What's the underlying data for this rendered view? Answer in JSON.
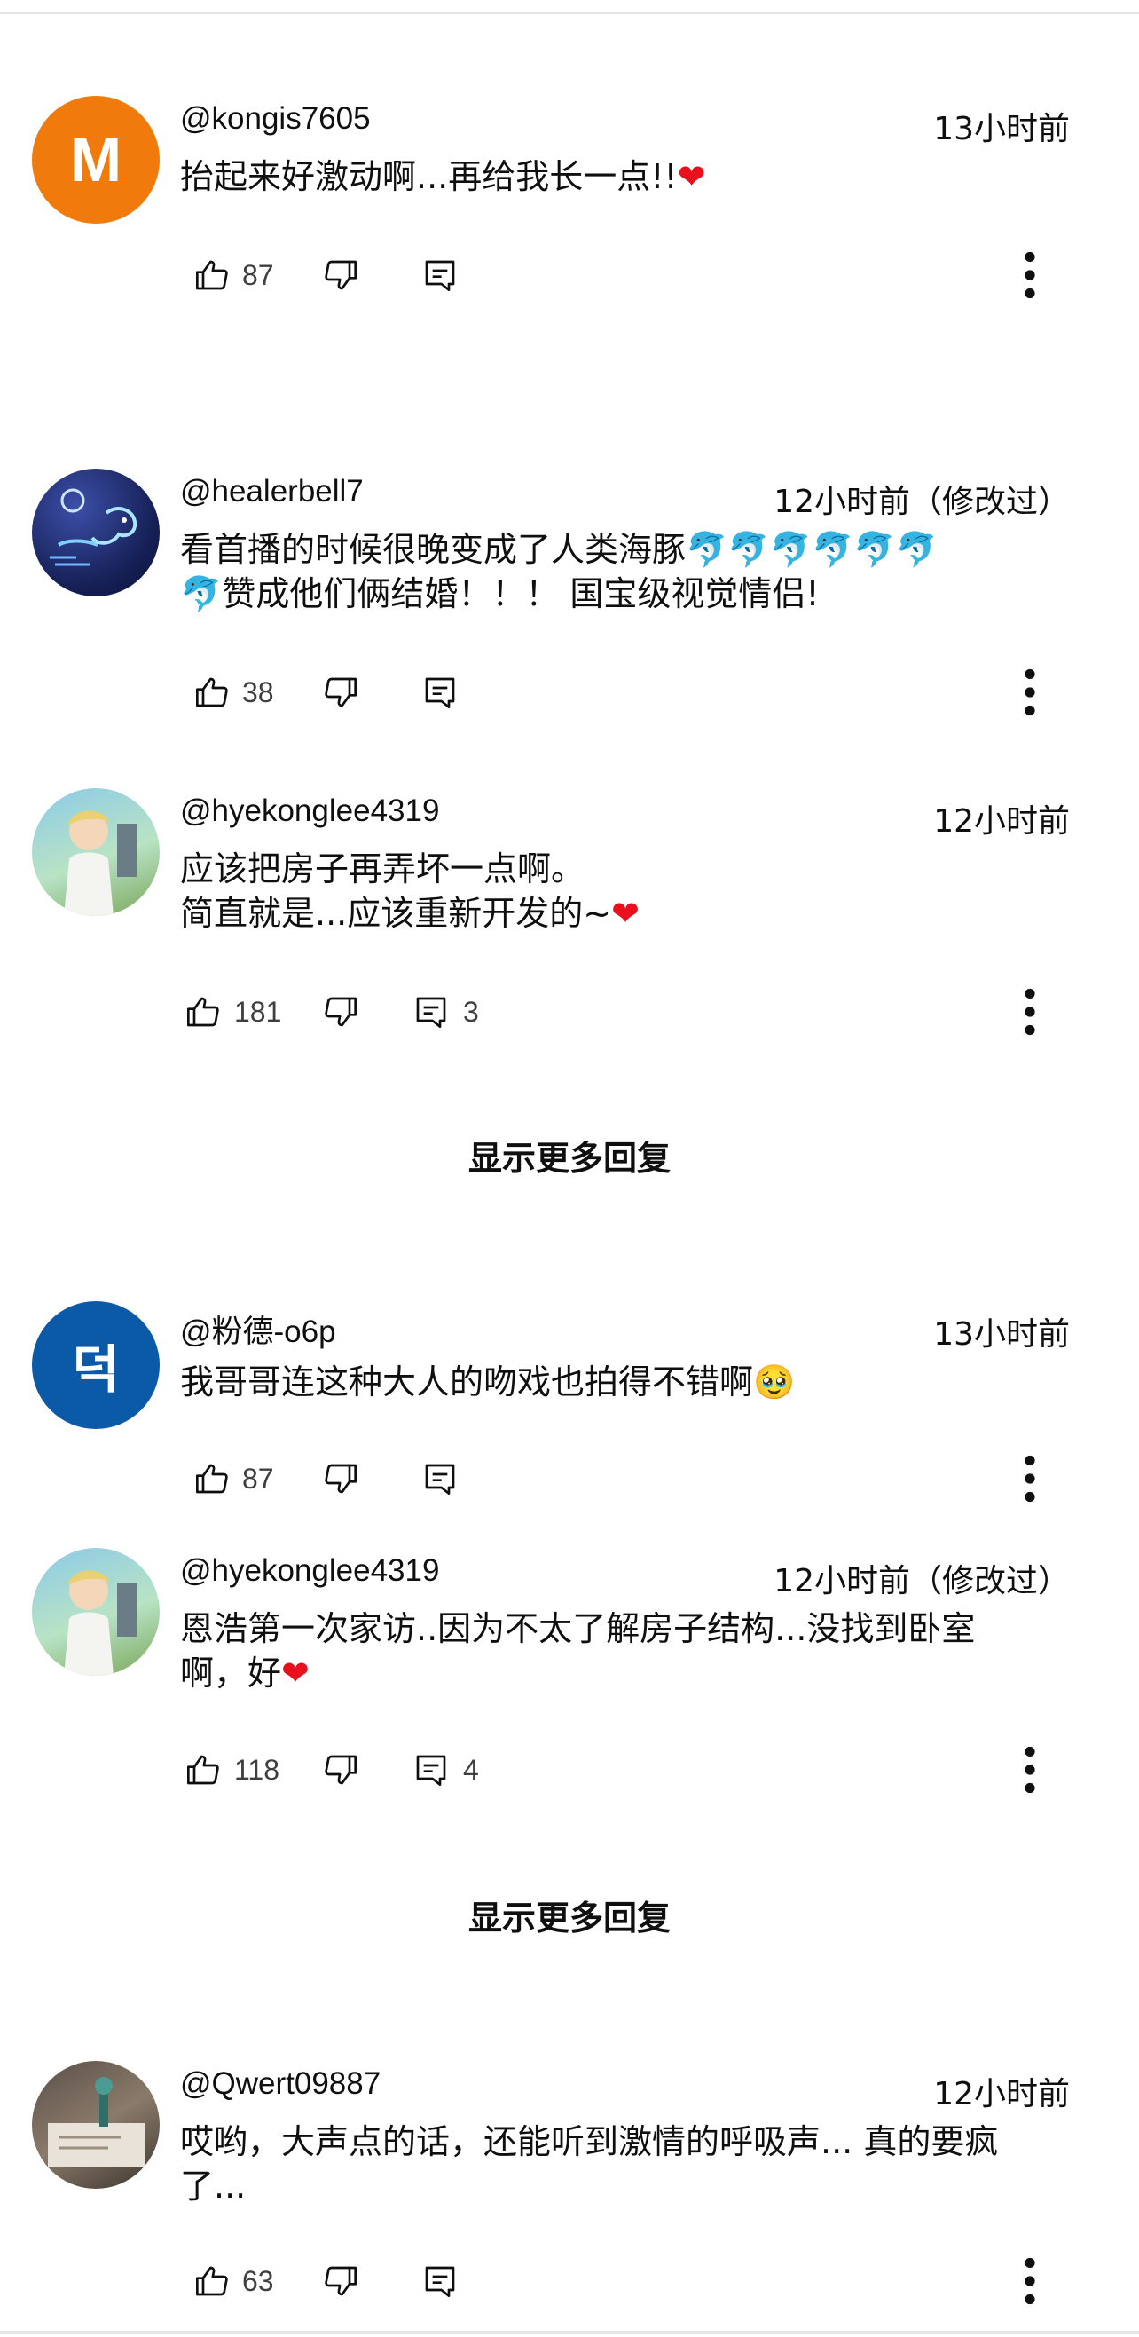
{
  "comments": [
    {
      "author": "@kongis7605",
      "avatar_letter": "M",
      "time": "13小时前",
      "text_parts": [
        "抬起来好激动啊...再给我长一点!!"
      ],
      "heart": "❤",
      "likes": "87",
      "replies": ""
    },
    {
      "author": "@healerbell7",
      "time": "12小时前（修改过）",
      "line1": "看首播的时候很晚变成了人类海豚",
      "dolphins": "🐬🐬🐬🐬🐬🐬",
      "dolphin_single": "🐬",
      "line2": "赞成他们俩结婚！！！ 国宝级视觉情侣!",
      "likes": "38",
      "replies": ""
    },
    {
      "author": "@hyekonglee4319",
      "time": "12小时前",
      "line1": "应该把房子再弄坏一点啊。",
      "line2": "简直就是...应该重新开发的~",
      "heart": "❤",
      "likes": "181",
      "replies": "3"
    },
    {
      "author": "@粉德-o6p",
      "avatar_letter": "덕",
      "time": "13小时前",
      "line1": "我哥哥连这种大人的吻戏也拍得不错啊",
      "emoji": "🥹",
      "likes": "87",
      "replies": ""
    },
    {
      "author": "@hyekonglee4319",
      "time": "12小时前（修改过）",
      "line1": "恩浩第一次家访..因为不太了解房子结构...没找到卧室",
      "line2": "啊，好",
      "heart": "❤",
      "likes": "118",
      "replies": "4"
    },
    {
      "author": "@Qwert09887",
      "time": "12小时前",
      "line1": "哎哟，大声点的话，还能听到激情的呼吸声... 真的要疯",
      "line2": "了...",
      "likes": "63",
      "replies": ""
    }
  ],
  "show_more_replies": "显示更多回复",
  "icons": {
    "like": "thumbs-up-icon",
    "dislike": "thumbs-down-icon",
    "reply": "reply-icon",
    "more": "more-vertical-icon"
  },
  "colors": {
    "avatar_orange": "#f07a0c",
    "avatar_blue": "#0b5aa8",
    "heart": "#e8101c"
  }
}
